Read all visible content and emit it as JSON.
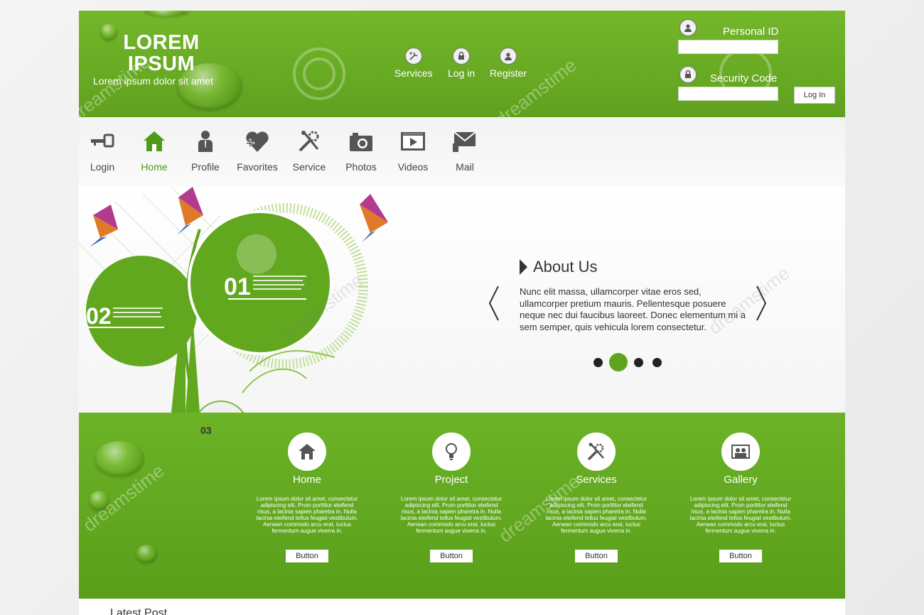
{
  "brand": {
    "title": "LOREM IPSUM",
    "tagline": "Lorem ipsum dolor sit amet"
  },
  "top_nav": [
    {
      "label": "Services",
      "icon": "tools-icon"
    },
    {
      "label": "Log in",
      "icon": "lock-icon"
    },
    {
      "label": "Register",
      "icon": "user-icon"
    }
  ],
  "login": {
    "personal_id_label": "Personal ID",
    "personal_id_value": "",
    "security_code_label": "Security Code",
    "security_code_value": "",
    "button": "Log In"
  },
  "icon_bar": {
    "active": "Home",
    "items": [
      {
        "label": "Login",
        "icon": "key-icon"
      },
      {
        "label": "Home",
        "icon": "home-icon"
      },
      {
        "label": "Profile",
        "icon": "person-icon"
      },
      {
        "label": "Favorites",
        "icon": "heart-plus-icon"
      },
      {
        "label": "Service",
        "icon": "tools-icon"
      },
      {
        "label": "Photos",
        "icon": "camera-icon"
      },
      {
        "label": "Videos",
        "icon": "video-icon"
      },
      {
        "label": "Mail",
        "icon": "mail-icon"
      }
    ]
  },
  "hero": {
    "bubbles": [
      "01",
      "02",
      "03"
    ],
    "about_title": "About Us",
    "about_text": "Nunc elit massa, ullamcorper vitae eros sed, ullamcorper pretium mauris. Pellentesque posuere neque nec dui faucibus laoreet. Donec elementum mi a sem semper, quis vehicula lorem consectetur.",
    "slides": 4,
    "active_slide": 2
  },
  "features": [
    {
      "title": "Home",
      "icon": "home-icon",
      "text": "Lorem ipsum dolor sit amet, consectetur adipiscing elit. Proin porttitor eleifend risus, a lacinia sapien pharetra in. Nulla lacinia eleifend tellus feugiat vestibulum. Aenean commodo arcu erat, luctus fermentum augue viverra in.",
      "button": "Button"
    },
    {
      "title": "Project",
      "icon": "lightbulb-icon",
      "text": "Lorem ipsum dolor sit amet, consectetur adipiscing elit. Proin porttitor eleifend risus, a lacinia sapien pharetra in. Nulla lacinia eleifend tellus feugiat vestibulum. Aenean commodo arcu erat, luctus fermentum augue viverra in.",
      "button": "Button"
    },
    {
      "title": "Services",
      "icon": "tools-icon",
      "text": "Lorem ipsum dolor sit amet, consectetur adipiscing elit. Proin porttitor eleifend risus, a lacinia sapien pharetra in. Nulla lacinia eleifend tellus feugiat vestibulum. Aenean commodo arcu erat, luctus fermentum augue viverra in.",
      "button": "Button"
    },
    {
      "title": "Gallery",
      "icon": "gallery-icon",
      "text": "Lorem ipsum dolor sit amet, consectetur adipiscing elit. Proin porttitor eleifend risus, a lacinia sapien pharetra in. Nulla lacinia eleifend tellus feugiat vestibulum. Aenean commodo arcu erat, luctus fermentum augue viverra in.",
      "button": "Button"
    }
  ],
  "latest_title": "Latest Post",
  "watermark": "dreamstime",
  "colors": {
    "primary_green": "#6cb327",
    "dark_green": "#4f9a16",
    "text_dark": "#333333"
  }
}
